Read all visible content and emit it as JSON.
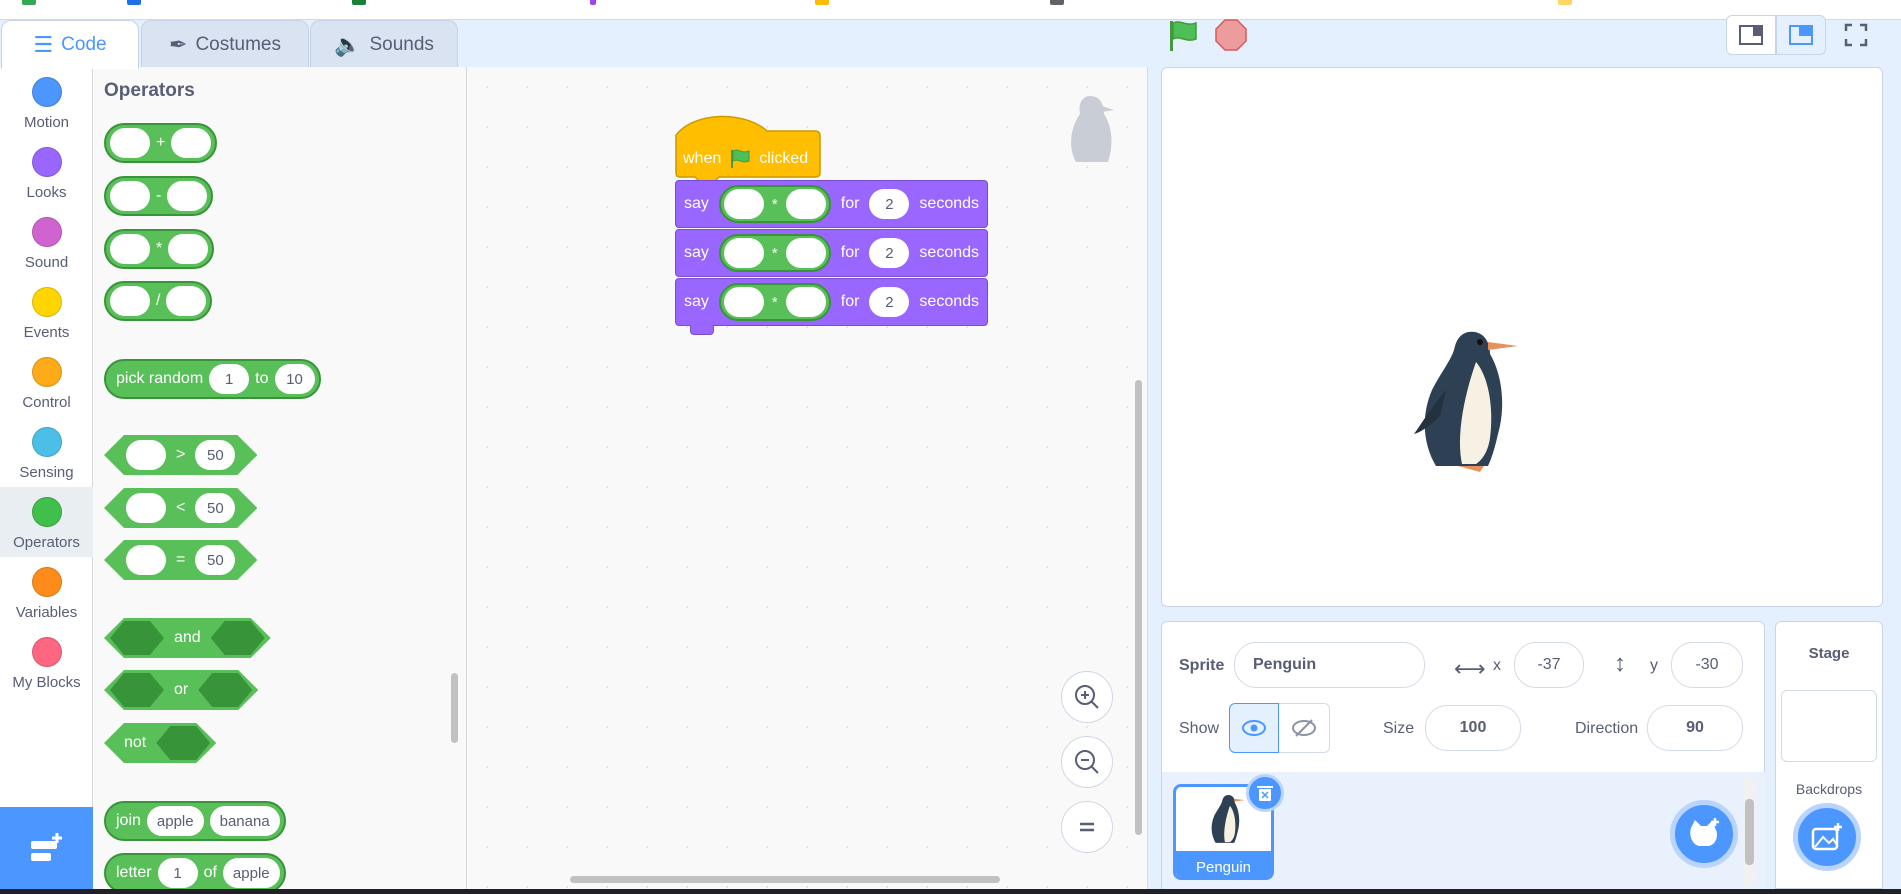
{
  "tabs": [
    {
      "label": "Code",
      "icon": "code-icon"
    },
    {
      "label": "Costumes",
      "icon": "brush-icon"
    },
    {
      "label": "Sounds",
      "icon": "speaker-icon"
    }
  ],
  "categories": [
    {
      "label": "Motion",
      "color": "#4c97ff"
    },
    {
      "label": "Looks",
      "color": "#9966ff"
    },
    {
      "label": "Sound",
      "color": "#cf63cf"
    },
    {
      "label": "Events",
      "color": "#ffd500"
    },
    {
      "label": "Control",
      "color": "#ffab19"
    },
    {
      "label": "Sensing",
      "color": "#4cbfe6"
    },
    {
      "label": "Operators",
      "color": "#40bf4a"
    },
    {
      "label": "Variables",
      "color": "#ff8c1a"
    },
    {
      "label": "My Blocks",
      "color": "#ff6680"
    }
  ],
  "palette": {
    "title": "Operators",
    "arith": [
      "+",
      "-",
      "*",
      "/"
    ],
    "pick_random": {
      "label": "pick random",
      "from": "1",
      "to_label": "to",
      "to": "10"
    },
    "compare": [
      {
        "op": ">",
        "value": "50"
      },
      {
        "op": "<",
        "value": "50"
      },
      {
        "op": "=",
        "value": "50"
      }
    ],
    "logic": {
      "and": "and",
      "or": "or",
      "not": "not"
    },
    "join": {
      "label": "join",
      "a": "apple",
      "b": "banana"
    },
    "letter": {
      "label": "letter",
      "index": "1",
      "of": "of",
      "word": "apple"
    }
  },
  "script": {
    "hat_when": "when",
    "hat_clicked": "clicked",
    "say_rows": [
      {
        "say": "say",
        "op": "*",
        "for": "for",
        "secs": "2",
        "unit": "seconds"
      },
      {
        "say": "say",
        "op": "*",
        "for": "for",
        "secs": "2",
        "unit": "seconds"
      },
      {
        "say": "say",
        "op": "*",
        "for": "for",
        "secs": "2",
        "unit": "seconds"
      }
    ]
  },
  "sprite_info": {
    "sprite_label": "Sprite",
    "sprite_name": "Penguin",
    "x_label": "x",
    "x_value": "-37",
    "y_label": "y",
    "y_value": "-30",
    "show_label": "Show",
    "size_label": "Size",
    "size_value": "100",
    "direction_label": "Direction",
    "direction_value": "90"
  },
  "sprite_tile": {
    "name": "Penguin"
  },
  "stage_panel": {
    "title": "Stage",
    "backdrops_label": "Backdrops"
  },
  "colors": {
    "accent": "#4c97ff",
    "operators": "#59c059",
    "looks": "#9966ff",
    "events": "#ffbf00"
  }
}
